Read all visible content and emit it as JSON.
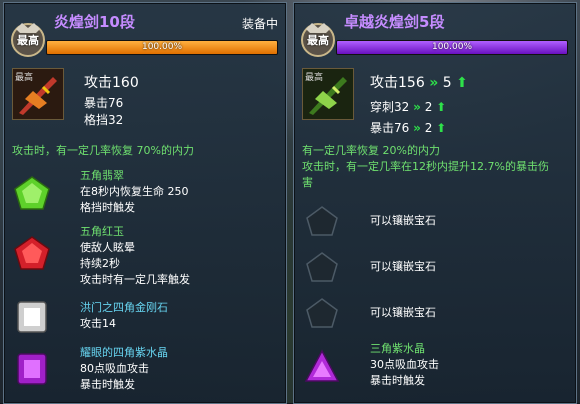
{
  "left": {
    "title": "炎煌剑10段",
    "status": "装备中",
    "progress_text": "100.00%",
    "progress": 1.0,
    "badge": "最高",
    "icon_tag": "最高",
    "stats": {
      "attack": "攻击160",
      "crit": "暴击76",
      "block": "格挡32"
    },
    "desc": "攻击时，有一定几率恢复 70%的内力",
    "gems": [
      {
        "name": "五角翡翠",
        "lines": [
          "在8秒内恢复生命 250",
          "格挡时触发"
        ]
      },
      {
        "name": "五角红玉",
        "lines": [
          "使敌人眩晕",
          "持续2秒",
          "攻击时有一定几率触发"
        ]
      },
      {
        "name": "洪门之四角金刚石",
        "lines": [
          "攻击14"
        ]
      },
      {
        "name": "耀眼的四角紫水晶",
        "lines": [
          "80点吸血攻击",
          "暴击时触发"
        ]
      }
    ]
  },
  "right": {
    "title": "卓越炎煌剑5段",
    "progress_text": "100.00%",
    "progress": 1.0,
    "badge": "最高",
    "icon_tag": "最高",
    "stats": {
      "attack": "攻击156",
      "attack_up": "5",
      "pierce": "穿刺32",
      "pierce_up": "2",
      "crit": "暴击76",
      "crit_up": "2"
    },
    "desc": [
      "有一定几率恢复 20%的内力",
      "攻击时，有一定几率在12秒内提升12.7%的暴击伤",
      "害"
    ],
    "slots": [
      "可以镶嵌宝石",
      "可以镶嵌宝石",
      "可以镶嵌宝石"
    ],
    "gem": {
      "name": "三角紫水晶",
      "lines": [
        "30点吸血攻击",
        "暴击时触发"
      ]
    }
  },
  "colors": {
    "left_title": "#c58cff",
    "right_title": "#c58cff",
    "left_bar": "#f08a18",
    "right_bar": "#8a2be2"
  }
}
